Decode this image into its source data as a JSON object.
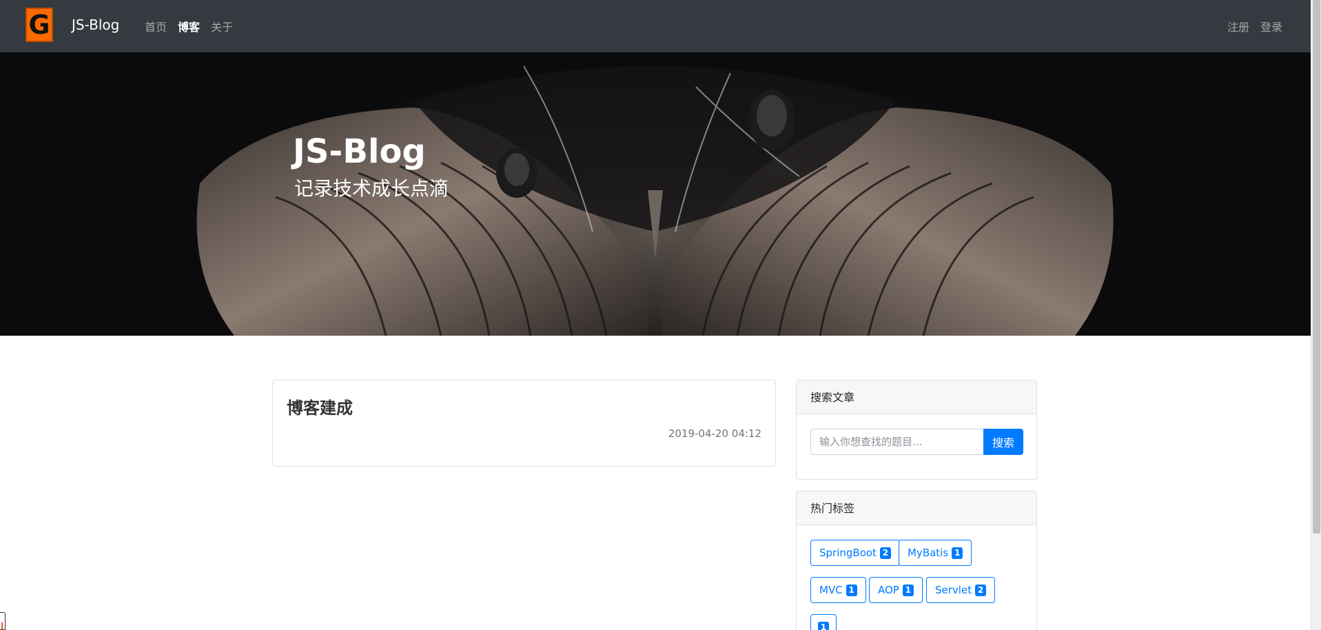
{
  "navbar": {
    "logo_letter": "G",
    "brand": "JS-Blog",
    "links": [
      {
        "label": "首页",
        "active": false
      },
      {
        "label": "博客",
        "active": true
      },
      {
        "label": "关于",
        "active": false
      }
    ],
    "register": "注册",
    "login": "登录"
  },
  "hero": {
    "title": "JS-Blog",
    "subtitle": "记录技术成长点滴"
  },
  "posts": [
    {
      "title": "博客建成",
      "date": "2019-04-20 04:12"
    }
  ],
  "search": {
    "header": "搜索文章",
    "placeholder": "输入你想查找的题目...",
    "button": "搜索"
  },
  "tags": {
    "header": "热门标签",
    "items": [
      {
        "name": "SpringBoot",
        "count": "2"
      },
      {
        "name": "MyBatis",
        "count": "1"
      },
      {
        "name": "MVC",
        "count": "1"
      },
      {
        "name": "AOP",
        "count": "1"
      },
      {
        "name": "Servlet",
        "count": "2"
      },
      {
        "name": "",
        "count": "1"
      }
    ]
  },
  "colors": {
    "navbar_bg": "#343a40",
    "primary": "#007bff",
    "logo": "#ff6a00"
  }
}
